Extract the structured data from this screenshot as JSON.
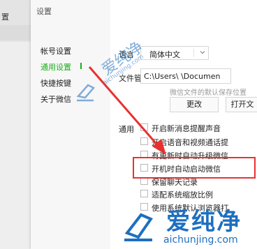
{
  "background_app": {
    "left_text": "置"
  },
  "window": {
    "title": "设置"
  },
  "sidebar": {
    "items": [
      {
        "label": "帐号设置",
        "active": false
      },
      {
        "label": "通用设置",
        "active": true
      },
      {
        "label": "快捷按键",
        "active": false
      },
      {
        "label": "关于微信",
        "active": false
      }
    ]
  },
  "general": {
    "language_label": "语言",
    "language_value": "简体中文",
    "file_mgmt_label": "文件管理",
    "file_path": "C:\\Users\\        \\Documen",
    "file_hint": "微信文件的默认保存位置",
    "change_button": "更改",
    "open_button": "打开文",
    "section_label": "通用",
    "options": [
      {
        "label": "开启新消息提醒声音",
        "checked": false
      },
      {
        "label": "开启语音和视频通话提",
        "checked": false
      },
      {
        "label": "有更新时自动升级微信",
        "checked": false
      },
      {
        "label": "开机时自动启动微信",
        "checked": false,
        "highlighted": true
      },
      {
        "label": "保留聊天记录",
        "checked": false
      },
      {
        "label": "适配系统缩放比例",
        "checked": false
      },
      {
        "label": "使用系统默认浏览器打",
        "checked": false
      }
    ]
  },
  "watermark": {
    "brand_cn": "爱纯净",
    "brand_url": "aichunjing.com"
  },
  "colors": {
    "accent_green": "#1aad19",
    "annotation_red": "#e8312f",
    "watermark_blue": "#1e6fbf"
  }
}
